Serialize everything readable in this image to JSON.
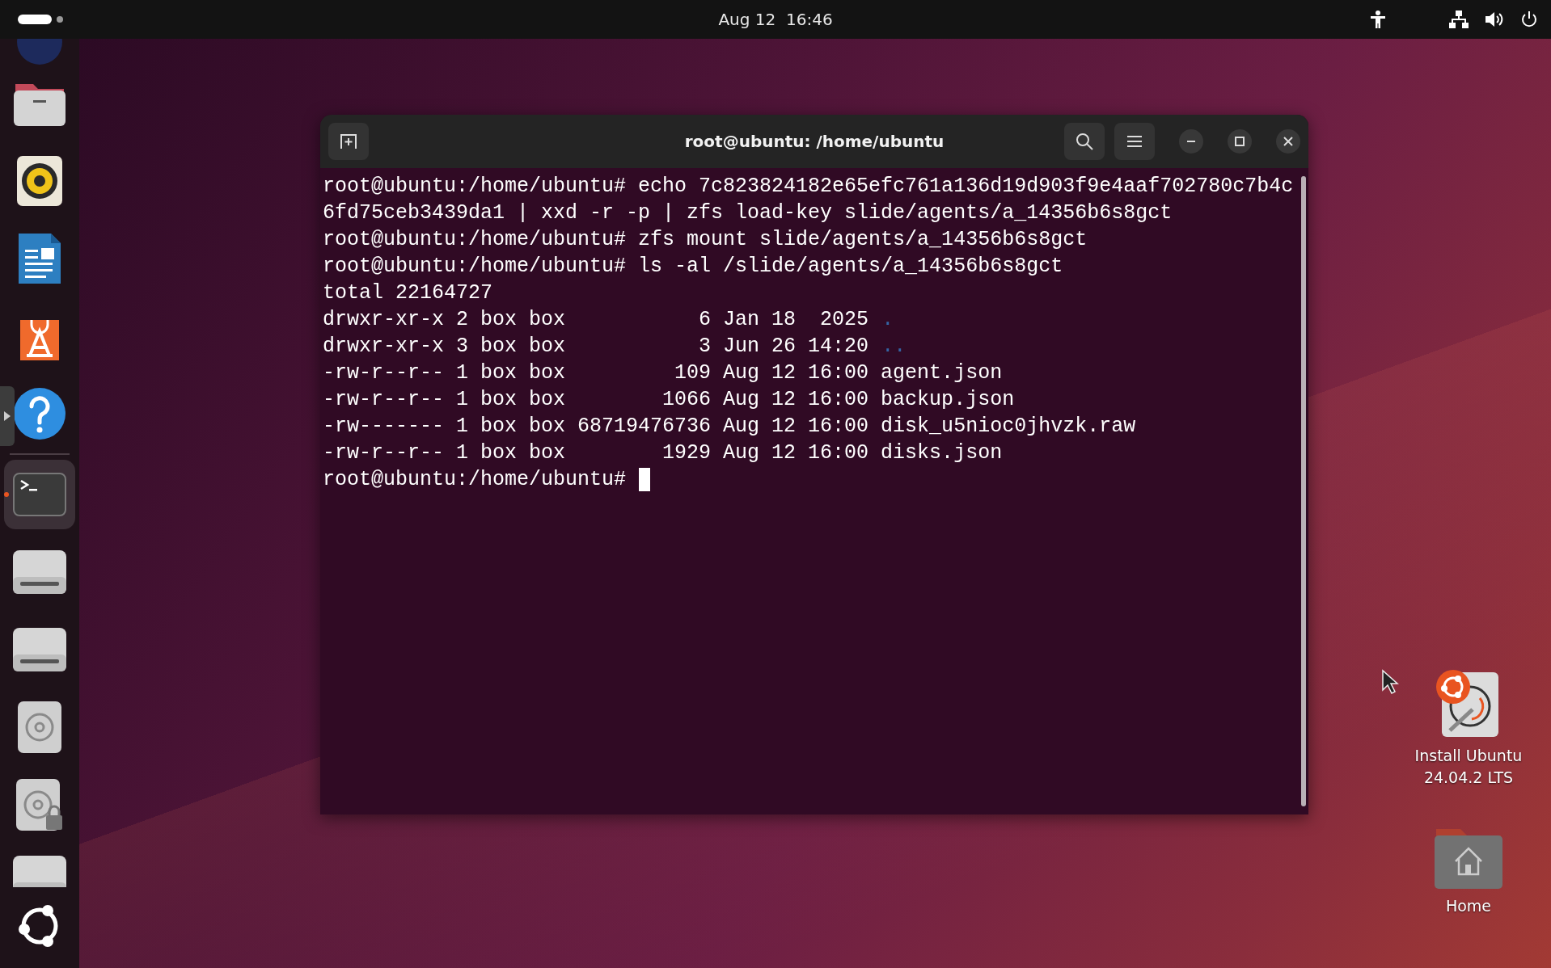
{
  "top_bar": {
    "clock": "Aug 12  16:46"
  },
  "dock": {
    "pinned": [
      {
        "kind": "round-app",
        "clipped": true,
        "running": false,
        "selected": false
      },
      {
        "kind": "files",
        "clipped": false,
        "running": false,
        "selected": false
      },
      {
        "kind": "speaker",
        "clipped": false,
        "running": false,
        "selected": false
      },
      {
        "kind": "writer",
        "clipped": false,
        "running": false,
        "selected": false
      },
      {
        "kind": "store",
        "clipped": false,
        "running": false,
        "selected": false
      },
      {
        "kind": "help",
        "clipped": false,
        "running": false,
        "selected": false
      }
    ],
    "others": [
      {
        "kind": "terminal",
        "clipped": false,
        "running": true,
        "selected": true
      },
      {
        "kind": "drive",
        "clipped": false,
        "running": false,
        "selected": false
      },
      {
        "kind": "drive",
        "clipped": false,
        "running": false,
        "selected": false
      },
      {
        "kind": "disc",
        "clipped": false,
        "running": false,
        "selected": false
      },
      {
        "kind": "locked-disc",
        "clipped": false,
        "running": false,
        "selected": false
      },
      {
        "kind": "drive",
        "clipped": true,
        "running": false,
        "selected": false
      }
    ]
  },
  "terminal": {
    "title": "root@ubuntu: /home/ubuntu",
    "lines": [
      {
        "text": "root@ubuntu:/home/ubuntu# echo 7c823824182e65efc761a136d19d903f9e4aaf702780c7b4c"
      },
      {
        "text": "6fd75ceb3439da1 | xxd -r -p | zfs load-key slide/agents/a_14356b6s8gct"
      },
      {
        "text": "root@ubuntu:/home/ubuntu# zfs mount slide/agents/a_14356b6s8gct"
      },
      {
        "text": "root@ubuntu:/home/ubuntu# ls -al /slide/agents/a_14356b6s8gct"
      },
      {
        "text": "total 22164727"
      },
      {
        "text": "drwxr-xr-x 2 box box           6 Jan 18  2025",
        "dir": "."
      },
      {
        "text": "drwxr-xr-x 3 box box           3 Jun 26 14:20",
        "dir": ".."
      },
      {
        "text": "-rw-r--r-- 1 box box         109 Aug 12 16:00 agent.json"
      },
      {
        "text": "-rw-r--r-- 1 box box        1066 Aug 12 16:00 backup.json"
      },
      {
        "text": "-rw------- 1 box box 68719476736 Aug 12 16:00 disk_u5nioc0jhvzk.raw"
      },
      {
        "text": "-rw-r--r-- 1 box box        1929 Aug 12 16:00 disks.json"
      },
      {
        "text": "root@ubuntu:/home/ubuntu#",
        "cursor": true
      }
    ]
  },
  "desktop_icons": [
    {
      "kind": "installer",
      "label": "Install Ubuntu\n24.04.2 LTS"
    },
    {
      "kind": "home",
      "label": "Home"
    }
  ]
}
